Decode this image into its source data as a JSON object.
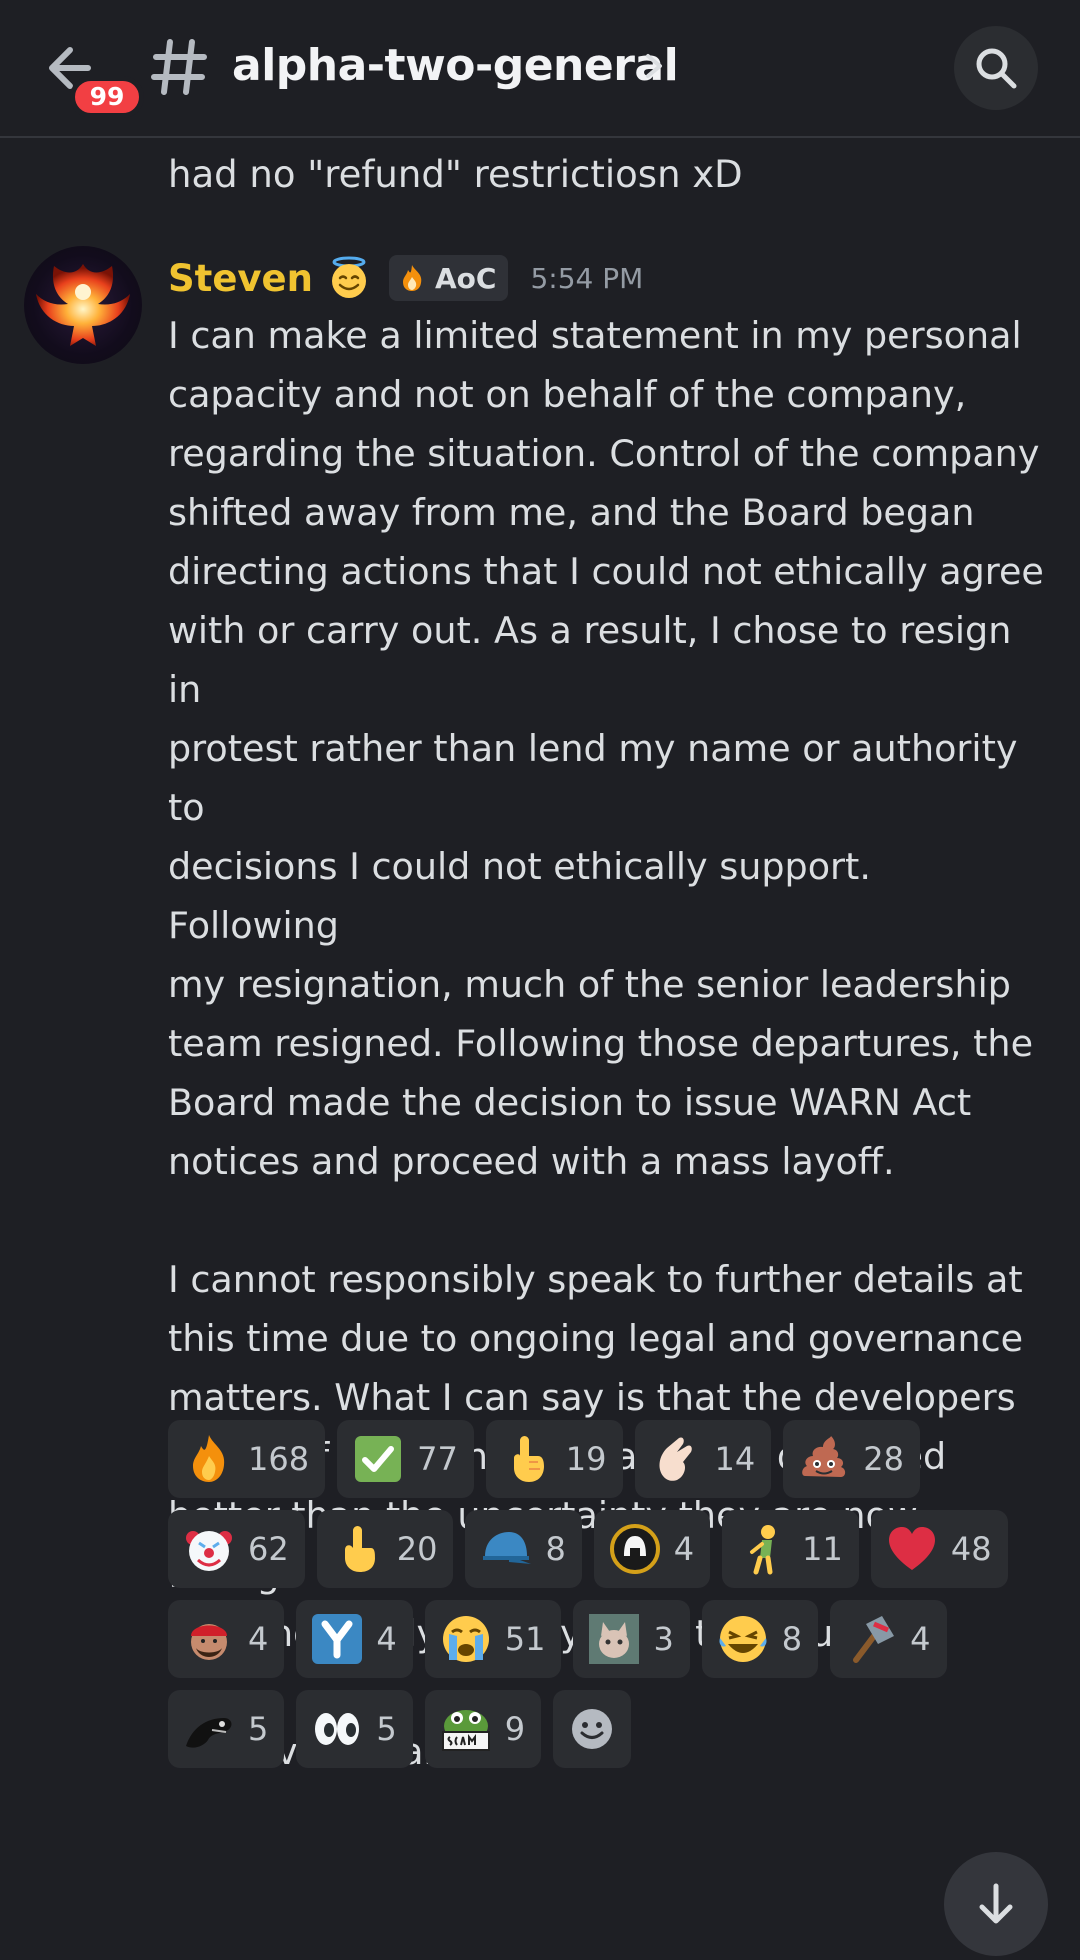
{
  "header": {
    "unread_badge": "99",
    "channel_name": "alpha-two-general"
  },
  "previous_message": {
    "text": "had no \"refund\" restrictiosn xD"
  },
  "message": {
    "author": "Steven",
    "author_color": "#f0c330",
    "tag_label": "AoC",
    "timestamp": "5:54 PM",
    "body": "I can make a limited statement in my personal\ncapacity and not on behalf of the company,\nregarding the situation. Control of the company\nshifted away from me, and the Board began\ndirecting actions that I could not ethically agree\nwith or carry out. As a result, I chose to resign in\nprotest rather than lend my name or authority to\ndecisions I could not ethically support. Following\nmy resignation, much of the senior leadership\nteam resigned. Following those departures, the\nBoard made the decision to issue WARN Act\nnotices and proceed with a mass layoff.\n\nI cannot responsibly speak to further details at\nthis time due to ongoing legal and governance\nmatters. What I can say is that the developers\nand staff acted in good faith and deserved\nbetter than the uncertainty they are now facing.\nI am incredibly dismayed by the situation.\n\n— Steven Sharif"
  },
  "reactions": [
    {
      "icon": "fire-emoji",
      "count": "168"
    },
    {
      "icon": "check-mark-emoji",
      "count": "77"
    },
    {
      "icon": "pointing-up-hand-emoji",
      "count": "19"
    },
    {
      "icon": "pinching-hand-emoji",
      "count": "14"
    },
    {
      "icon": "poop-emoji",
      "count": "28"
    },
    {
      "icon": "clown-emoji",
      "count": "62"
    },
    {
      "icon": "middle-finger-emoji",
      "count": "20"
    },
    {
      "icon": "blue-cap-emoji",
      "count": "8"
    },
    {
      "icon": "helmet-logo-emoji",
      "count": "4"
    },
    {
      "icon": "person-bending-emoji",
      "count": "11"
    },
    {
      "icon": "red-heart-emoji",
      "count": "48"
    },
    {
      "icon": "red-hat-man-emoji",
      "count": "4"
    },
    {
      "icon": "y-letter-emoji",
      "count": "4"
    },
    {
      "icon": "crying-face-emoji",
      "count": "51"
    },
    {
      "icon": "cat-photo-emoji",
      "count": "3"
    },
    {
      "icon": "laughing-tears-emoji",
      "count": "8"
    },
    {
      "icon": "ban-hammer-emoji",
      "count": "4"
    },
    {
      "icon": "black-creature-emoji",
      "count": "5"
    },
    {
      "icon": "eyes-emoji",
      "count": "5"
    },
    {
      "icon": "scam-frog-emoji",
      "count": "9"
    }
  ],
  "colors": {
    "background": "#1e1f24",
    "reaction_bg": "#2b2d31",
    "badge_red": "#f23f43"
  }
}
